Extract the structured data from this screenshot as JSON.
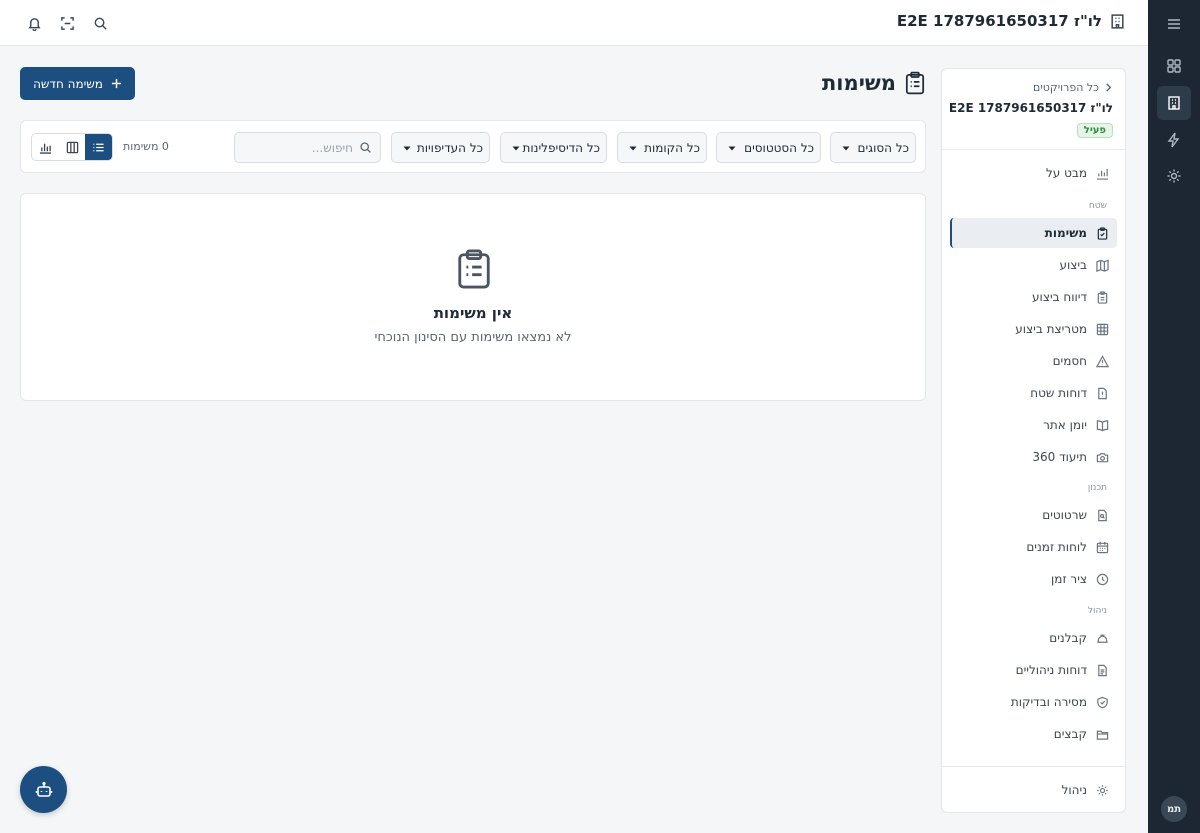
{
  "topbar": {
    "project_title": "E2E לו\"ז 1787961650317",
    "icons": [
      "bell-icon",
      "scan-icon",
      "search-icon",
      "building-icon"
    ]
  },
  "rail": {
    "items": [
      "menu-icon",
      "grid-icon",
      "building-icon",
      "bolt-icon",
      "gear-icon"
    ],
    "active": "building-icon",
    "avatar": "תמ"
  },
  "sidebar": {
    "back_label": "כל הפרויקטים",
    "project_name": "E2E לו\"ז 1787961650317",
    "status": "פעיל",
    "overview": {
      "label": "מבט על",
      "icon": "chart-icon"
    },
    "sections": [
      {
        "title": "שטח",
        "items": [
          {
            "label": "משימות",
            "icon": "clipboard-icon",
            "active": true
          },
          {
            "label": "ביצוע",
            "icon": "map-icon"
          },
          {
            "label": "דיווח ביצוע",
            "icon": "clipboard-list-icon"
          },
          {
            "label": "מטריצת ביצוע",
            "icon": "table-icon"
          },
          {
            "label": "חסמים",
            "icon": "warning-icon"
          },
          {
            "label": "דוחות שטח",
            "icon": "file-alert-icon"
          },
          {
            "label": "יומן אתר",
            "icon": "book-icon"
          },
          {
            "label": "תיעוד 360",
            "icon": "camera-icon"
          }
        ]
      },
      {
        "title": "תכנון",
        "items": [
          {
            "label": "שרטוטים",
            "icon": "file-search-icon"
          },
          {
            "label": "לוחות זמנים",
            "icon": "calendar-icon"
          },
          {
            "label": "ציר זמן",
            "icon": "clock-icon"
          }
        ]
      },
      {
        "title": "ניהול",
        "items": [
          {
            "label": "קבלנים",
            "icon": "hardhat-icon"
          },
          {
            "label": "דוחות ניהוליים",
            "icon": "file-text-icon"
          },
          {
            "label": "מסירה ובדיקות",
            "icon": "shield-icon"
          },
          {
            "label": "קבצים",
            "icon": "folder-icon"
          }
        ]
      }
    ],
    "footer": {
      "label": "ניהול",
      "icon": "gear-icon"
    }
  },
  "main": {
    "title": "משימות",
    "new_button": "משימה חדשה",
    "filters": [
      "כל הסוגים",
      "כל הסטטוסים",
      "כל הקומות",
      "כל הדיסיפלינות",
      "כל העדיפויות"
    ],
    "search_placeholder": "חיפוש...",
    "search_value": "",
    "count_label": "0 משימות",
    "view_modes": [
      "list-view-icon",
      "board-view-icon",
      "chart-view-icon"
    ],
    "active_view": "list-view-icon",
    "empty": {
      "title": "אין משימות",
      "subtitle": "לא נמצאו משימות עם הסינון הנוכחי"
    }
  },
  "colors": {
    "primary": "#1c4e80",
    "rail_bg": "#1c2733",
    "status_green": "#2f8a3f",
    "page_bg": "#f4f6f8"
  }
}
